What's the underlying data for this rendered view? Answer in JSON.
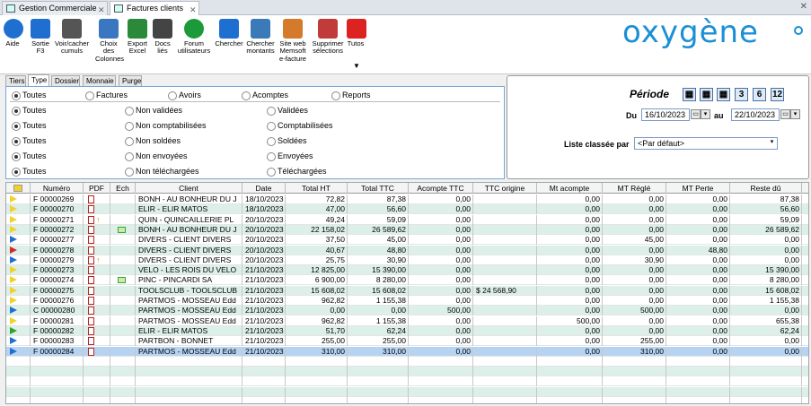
{
  "tabs": [
    {
      "label": "Gestion Commerciale",
      "active": false
    },
    {
      "label": "Factures clients",
      "active": true
    }
  ],
  "toolbar": [
    {
      "label": "Aide",
      "icon": "help-icon"
    },
    {
      "label": "Sortie\nF3",
      "icon": "exit-icon"
    },
    {
      "label": "Voir/cacher\ncumuls",
      "icon": "sum-icon"
    },
    {
      "label": "Choix\ndes\nColonnes",
      "icon": "columns-icon"
    },
    {
      "label": "Export\nExcel",
      "icon": "excel-icon"
    },
    {
      "label": "Docs\nliés",
      "icon": "docs-icon"
    },
    {
      "label": "Forum\nutilisateurs",
      "icon": "forum-icon"
    },
    {
      "label": "Chercher",
      "icon": "search-icon"
    },
    {
      "label": "Chercher\nmontants",
      "icon": "search-amount-icon"
    },
    {
      "label": "Site web\nMemsoft\ne-facture",
      "icon": "web-icon"
    },
    {
      "label": "Supprimer\nsélections",
      "icon": "delete-icon"
    },
    {
      "label": "Tutos",
      "icon": "video-icon"
    }
  ],
  "logo": "oxygène",
  "filter_tabs": [
    "Tiers",
    "Type",
    "Dossier",
    "Monnaie",
    "Purge"
  ],
  "filters": {
    "row1": [
      "Toutes",
      "Factures",
      "Avoirs",
      "Acomptes",
      "Reports"
    ],
    "rows": [
      [
        "Toutes",
        "Non validées",
        "Validées"
      ],
      [
        "Toutes",
        "Non comptabilisées",
        "Comptabilisées"
      ],
      [
        "Toutes",
        "Non soldées",
        "Soldées"
      ],
      [
        "Toutes",
        "Non envoyées",
        "Envoyées"
      ],
      [
        "Toutes",
        "Non téléchargées",
        "Téléchargées"
      ]
    ]
  },
  "period": {
    "title": "Période",
    "du_label": "Du",
    "du": "16/10/2023",
    "au_label": "au",
    "au": "22/10/2023",
    "quick": [
      "3",
      "6",
      "12"
    ],
    "list_label": "Liste classée par",
    "list_value": "<Par défaut>"
  },
  "columns": [
    "Numéro",
    "PDF",
    "Ech",
    "Client",
    "Date",
    "Total HT",
    "Total TTC",
    "Acompte TTC",
    "TTC origine",
    "Mt acompte",
    "MT Réglé",
    "MT Perte",
    "Reste dû"
  ],
  "colors": {
    "yellow": "#f2d12a",
    "blue": "#1e6fd0",
    "red": "#d22a2a",
    "green": "#2aa52a"
  },
  "rows": [
    {
      "flag": "yellow",
      "num": "F 00000269",
      "client": "BONH - AU BONHEUR DU J",
      "date": "18/10/2023",
      "ht": "72,82",
      "ttc": "87,38",
      "acompte": "0,00",
      "orig": "",
      "mtac": "0,00",
      "regle": "0,00",
      "perte": "0,00",
      "reste": "87,38",
      "ech": false,
      "arrow": false
    },
    {
      "flag": "yellow",
      "num": "F 00000270",
      "client": "ELIR - ELIR MATOS",
      "date": "18/10/2023",
      "ht": "47,00",
      "ttc": "56,60",
      "acompte": "0,00",
      "orig": "",
      "mtac": "0,00",
      "regle": "0,00",
      "perte": "0,00",
      "reste": "56,60",
      "ech": false,
      "arrow": false
    },
    {
      "flag": "yellow",
      "num": "F 00000271",
      "client": "QUIN - QUINCAILLERIE PL",
      "date": "20/10/2023",
      "ht": "49,24",
      "ttc": "59,09",
      "acompte": "0,00",
      "orig": "",
      "mtac": "0,00",
      "regle": "0,00",
      "perte": "0,00",
      "reste": "59,09",
      "ech": false,
      "arrow": true
    },
    {
      "flag": "yellow",
      "num": "F 00000272",
      "client": "BONH - AU BONHEUR DU J",
      "date": "20/10/2023",
      "ht": "22 158,02",
      "ttc": "26 589,62",
      "acompte": "0,00",
      "orig": "",
      "mtac": "0,00",
      "regle": "0,00",
      "perte": "0,00",
      "reste": "26 589,62",
      "ech": true,
      "arrow": false
    },
    {
      "flag": "blue",
      "num": "F 00000277",
      "client": "DIVERS - CLIENT DIVERS",
      "date": "20/10/2023",
      "ht": "37,50",
      "ttc": "45,00",
      "acompte": "0,00",
      "orig": "",
      "mtac": "0,00",
      "regle": "45,00",
      "perte": "0,00",
      "reste": "0,00",
      "ech": false,
      "arrow": false
    },
    {
      "flag": "red",
      "num": "F 00000278",
      "client": "DIVERS - CLIENT DIVERS",
      "date": "20/10/2023",
      "ht": "40,67",
      "ttc": "48,80",
      "acompte": "0,00",
      "orig": "",
      "mtac": "0,00",
      "regle": "0,00",
      "perte": "48,80",
      "reste": "0,00",
      "ech": false,
      "arrow": false
    },
    {
      "flag": "blue",
      "num": "F 00000279",
      "client": "DIVERS - CLIENT DIVERS",
      "date": "20/10/2023",
      "ht": "25,75",
      "ttc": "30,90",
      "acompte": "0,00",
      "orig": "",
      "mtac": "0,00",
      "regle": "30,90",
      "perte": "0,00",
      "reste": "0,00",
      "ech": false,
      "arrow": true
    },
    {
      "flag": "yellow",
      "num": "F 00000273",
      "client": "VELO - LES ROIS DU VELO",
      "date": "21/10/2023",
      "ht": "12 825,00",
      "ttc": "15 390,00",
      "acompte": "0,00",
      "orig": "",
      "mtac": "0,00",
      "regle": "0,00",
      "perte": "0,00",
      "reste": "15 390,00",
      "ech": false,
      "arrow": false
    },
    {
      "flag": "yellow",
      "num": "F 00000274",
      "client": "PINC - PINCARDI SA",
      "date": "21/10/2023",
      "ht": "6 900,00",
      "ttc": "8 280,00",
      "acompte": "0,00",
      "orig": "",
      "mtac": "0,00",
      "regle": "0,00",
      "perte": "0,00",
      "reste": "8 280,00",
      "ech": true,
      "arrow": false
    },
    {
      "flag": "yellow",
      "num": "F 00000275",
      "client": "TOOLSCLUB - TOOLSCLUB",
      "date": "21/10/2023",
      "ht": "15 608,02",
      "ttc": "15 608,02",
      "acompte": "0,00",
      "orig": "$ 24 568,90",
      "mtac": "0,00",
      "regle": "0,00",
      "perte": "0,00",
      "reste": "15 608,02",
      "ech": false,
      "arrow": false
    },
    {
      "flag": "yellow",
      "num": "F 00000276",
      "client": "PARTMOS - MOSSEAU Edd",
      "date": "21/10/2023",
      "ht": "962,82",
      "ttc": "1 155,38",
      "acompte": "0,00",
      "orig": "",
      "mtac": "0,00",
      "regle": "0,00",
      "perte": "0,00",
      "reste": "1 155,38",
      "ech": false,
      "arrow": false
    },
    {
      "flag": "blue",
      "num": "C 00000280",
      "client": "PARTMOS - MOSSEAU Edd",
      "date": "21/10/2023",
      "ht": "0,00",
      "ttc": "0,00",
      "acompte": "500,00",
      "orig": "",
      "mtac": "0,00",
      "regle": "500,00",
      "perte": "0,00",
      "reste": "0,00",
      "ech": false,
      "arrow": false
    },
    {
      "flag": "yellow",
      "num": "F 00000281",
      "client": "PARTMOS - MOSSEAU Edd",
      "date": "21/10/2023",
      "ht": "962,82",
      "ttc": "1 155,38",
      "acompte": "0,00",
      "orig": "",
      "mtac": "500,00",
      "regle": "0,00",
      "perte": "0,00",
      "reste": "655,38",
      "ech": false,
      "arrow": false
    },
    {
      "flag": "green",
      "num": "F 00000282",
      "client": "ELIR - ELIR MATOS",
      "date": "21/10/2023",
      "ht": "51,70",
      "ttc": "62,24",
      "acompte": "0,00",
      "orig": "",
      "mtac": "0,00",
      "regle": "0,00",
      "perte": "0,00",
      "reste": "62,24",
      "ech": false,
      "arrow": false
    },
    {
      "flag": "blue",
      "num": "F 00000283",
      "client": "PARTBON - BONNET",
      "date": "21/10/2023",
      "ht": "255,00",
      "ttc": "255,00",
      "acompte": "0,00",
      "orig": "",
      "mtac": "0,00",
      "regle": "255,00",
      "perte": "0,00",
      "reste": "0,00",
      "ech": false,
      "arrow": false
    },
    {
      "flag": "blue",
      "num": "F 00000284",
      "client": "PARTMOS - MOSSEAU Edd",
      "date": "21/10/2023",
      "ht": "310,00",
      "ttc": "310,00",
      "acompte": "0,00",
      "orig": "",
      "mtac": "0,00",
      "regle": "310,00",
      "perte": "0,00",
      "reste": "0,00",
      "ech": false,
      "arrow": false
    }
  ]
}
